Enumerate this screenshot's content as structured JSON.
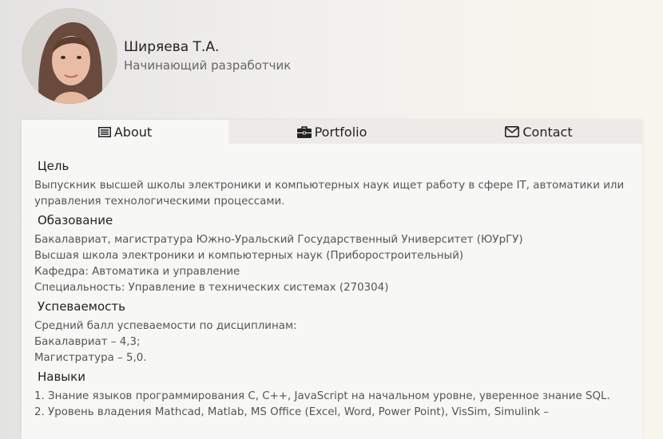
{
  "profile": {
    "name": "Ширяева Т.А.",
    "role": "Начинающий разработчик"
  },
  "tabs": [
    {
      "label": "About",
      "icon": "list-icon",
      "active": true
    },
    {
      "label": "Portfolio",
      "icon": "briefcase-icon",
      "active": false
    },
    {
      "label": "Contact",
      "icon": "envelope-icon",
      "active": false
    }
  ],
  "sections": {
    "goal": {
      "title": "Цель",
      "text": "Выпускник высшей школы электроники и компьютерных наук ищет работу в сфере IT, автоматики или управления технологическими процессами."
    },
    "education": {
      "title": "Обазование",
      "lines": [
        "Бакалавриат, магистратура Южно-Уральский Государственный Университет (ЮУрГУ)",
        "Высшая школа электроники и компьютерных наук (Приборостроительный)",
        "Кафедра: Автоматика и управление",
        "Специальность: Управление в технических системах (270304)"
      ]
    },
    "grades": {
      "title": "Успеваемость",
      "lines": [
        "Средний балл успеваемости по дисциплинам:",
        "Бакалавриат – 4,3;",
        "Магистратура – 5,0."
      ]
    },
    "skills": {
      "title": "Навыки",
      "lines": [
        "1. Знание языков программирования C, C++, JavaScript на начальном уровне, уверенное знание SQL.",
        "2. Уровень владения Mathcad, Matlab, MS Office (Excel, Word, Power Point), VisSim, Simulink –"
      ]
    }
  },
  "colors": {
    "active_tab": "#f7f7f6",
    "inactive_tab": "#ecebe8",
    "text": "#555555"
  }
}
